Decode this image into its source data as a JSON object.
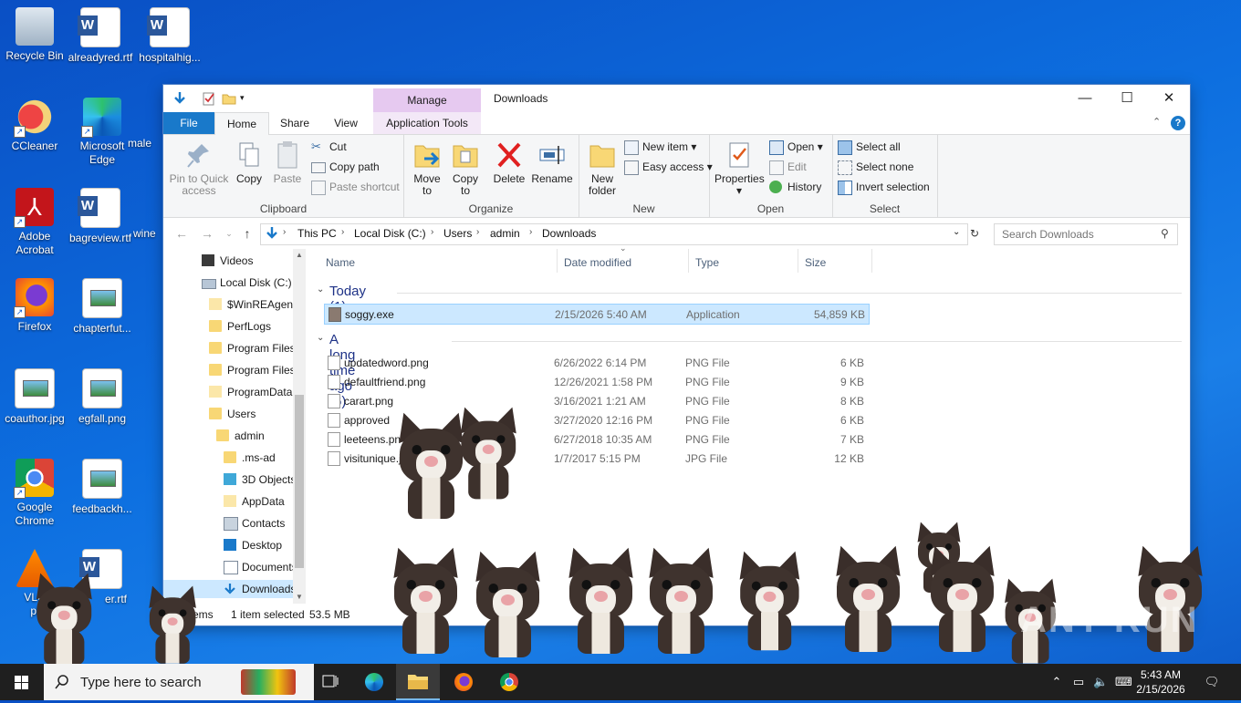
{
  "desktop": {
    "icons": [
      {
        "label": "Recycle Bin"
      },
      {
        "label": "alreadyred.rtf"
      },
      {
        "label": "hospitalhig..."
      },
      {
        "label": "CCleaner"
      },
      {
        "label": "Microsoft Edge"
      },
      {
        "label": "male"
      },
      {
        "label": "Adobe Acrobat"
      },
      {
        "label": "bagreview.rtf"
      },
      {
        "label": "wine"
      },
      {
        "label": "Firefox"
      },
      {
        "label": "chapterfut..."
      },
      {
        "label": "coauthor.jpg"
      },
      {
        "label": "egfall.png"
      },
      {
        "label": "Google Chrome"
      },
      {
        "label": "feedbackh..."
      },
      {
        "label": "VLC"
      },
      {
        "label": "pl"
      },
      {
        "label": "er.rtf"
      }
    ]
  },
  "window": {
    "title": "Downloads",
    "manage_tab": "Manage",
    "tabs": {
      "file": "File",
      "home": "Home",
      "share": "Share",
      "view": "View",
      "app_tools": "Application Tools"
    },
    "ribbon": {
      "clipboard": {
        "label": "Clipboard",
        "pin": "Pin to Quick access",
        "copy": "Copy",
        "paste": "Paste",
        "cut": "Cut",
        "copy_path": "Copy path",
        "paste_shortcut": "Paste shortcut"
      },
      "organize": {
        "label": "Organize",
        "move_to": "Move to",
        "copy_to": "Copy to",
        "delete": "Delete",
        "rename": "Rename"
      },
      "new": {
        "label": "New",
        "new_folder": "New folder",
        "new_item": "New item",
        "easy_access": "Easy access"
      },
      "open": {
        "label": "Open",
        "properties": "Properties",
        "open": "Open",
        "edit": "Edit",
        "history": "History"
      },
      "select": {
        "label": "Select",
        "select_all": "Select all",
        "select_none": "Select none",
        "invert": "Invert selection"
      }
    },
    "address": {
      "crumbs": [
        "This PC",
        "Local Disk (C:)",
        "Users",
        "admin",
        "Downloads"
      ],
      "search_placeholder": "Search Downloads"
    },
    "nav": [
      {
        "label": "Videos"
      },
      {
        "label": "Local Disk (C:)"
      },
      {
        "label": "$WinREAgent"
      },
      {
        "label": "PerfLogs"
      },
      {
        "label": "Program Files"
      },
      {
        "label": "Program Files"
      },
      {
        "label": "ProgramData"
      },
      {
        "label": "Users"
      },
      {
        "label": "admin"
      },
      {
        "label": ".ms-ad"
      },
      {
        "label": "3D Objects"
      },
      {
        "label": "AppData"
      },
      {
        "label": "Contacts"
      },
      {
        "label": "Desktop"
      },
      {
        "label": "Documents"
      },
      {
        "label": "Downloads"
      }
    ],
    "columns": {
      "name": "Name",
      "date": "Date modified",
      "type": "Type",
      "size": "Size"
    },
    "groups": {
      "today": "Today (1)",
      "older": "A long time ago (6)"
    },
    "files_today": [
      {
        "name": "soggy.exe",
        "date": "2/15/2026 5:40 AM",
        "type": "Application",
        "size": "54,859 KB"
      }
    ],
    "files_older": [
      {
        "name": "updatedword.png",
        "date": "6/26/2022 6:14 PM",
        "type": "PNG File",
        "size": "6 KB"
      },
      {
        "name": "defaultfriend.png",
        "date": "12/26/2021 1:58 PM",
        "type": "PNG File",
        "size": "9 KB"
      },
      {
        "name": "carart.png",
        "date": "3/16/2021 1:21 AM",
        "type": "PNG File",
        "size": "8 KB"
      },
      {
        "name": "approved",
        "date": "3/27/2020 12:16 PM",
        "type": "PNG File",
        "size": "6 KB"
      },
      {
        "name": "leeteens.pn",
        "date": "6/27/2018 10:35 AM",
        "type": "PNG File",
        "size": "7 KB"
      },
      {
        "name": "visitunique.j",
        "date": "1/7/2017 5:15 PM",
        "type": "JPG File",
        "size": "12 KB"
      }
    ],
    "status": {
      "items": "items",
      "selected": "1 item selected",
      "size": "53.5 MB"
    }
  },
  "watermark": "ANY RUN",
  "taskbar": {
    "search_placeholder": "Type here to search",
    "time": "5:43 AM",
    "date": "2/15/2026"
  },
  "colors": {
    "accent": "#1979ca",
    "selection": "#cce8ff",
    "manage": "#e6c9f0",
    "taskbar": "#1f1f1f"
  }
}
